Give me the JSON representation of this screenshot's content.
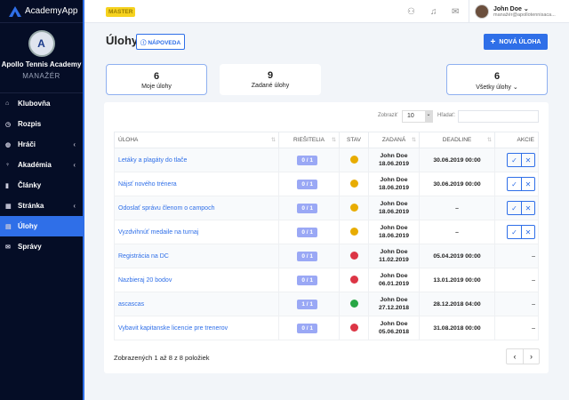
{
  "app": {
    "name": "AcademyApp"
  },
  "club": {
    "name": "Apollo Tennis Academy",
    "role": "MANAŽÉR",
    "logo_text": "A"
  },
  "sidebar": {
    "items": [
      {
        "label": "Klubovňa",
        "icon": "home-icon",
        "chev": false,
        "active": false
      },
      {
        "label": "Rozpis",
        "icon": "clock-icon",
        "chev": false,
        "active": false
      },
      {
        "label": "Hráči",
        "icon": "globe-icon",
        "chev": true,
        "active": false
      },
      {
        "label": "Akadémia",
        "icon": "trophy-icon",
        "chev": true,
        "active": false
      },
      {
        "label": "Články",
        "icon": "document-icon",
        "chev": false,
        "active": false
      },
      {
        "label": "Stránka",
        "icon": "layout-icon",
        "chev": true,
        "active": false
      },
      {
        "label": "Úlohy",
        "icon": "tasks-icon",
        "chev": false,
        "active": true
      },
      {
        "label": "Správy",
        "icon": "mail-icon",
        "chev": false,
        "active": false
      }
    ]
  },
  "topbar": {
    "badge": "MASTER",
    "user_name": "John Doe",
    "user_email": "manažér@apollotennisaca..."
  },
  "page": {
    "title": "Úlohy",
    "help": "NÁPOVEDA",
    "new_task": "NOVÁ ÚLOHA"
  },
  "stats": [
    {
      "value": "6",
      "label": "Moje úlohy"
    },
    {
      "value": "9",
      "label": "Zadané úlohy"
    },
    {
      "value": "6",
      "label": "Všetky úlohy"
    }
  ],
  "table": {
    "show_label": "Zobraziť",
    "show_value": "10",
    "search_label": "Hľadať:",
    "headers": [
      "ÚLOHA",
      "RIEŠITELIA",
      "STAV",
      "ZADANÁ",
      "DEADLINE",
      "AKCIE"
    ],
    "status_colors": {
      "pending": "#e8ac00",
      "failed": "#dc3545",
      "done": "#28a745"
    },
    "rows": [
      {
        "task": "Letáky a plagáty do tlače",
        "solvers": "0 / 1",
        "status": "pending",
        "by": "John Doe",
        "date": "18.06.2019",
        "deadline": "30.06.2019 00:00",
        "actions": true
      },
      {
        "task": "Nájsť nového trénera",
        "solvers": "0 / 1",
        "status": "pending",
        "by": "John Doe",
        "date": "18.06.2019",
        "deadline": "30.06.2019 00:00",
        "actions": true
      },
      {
        "task": "Odoslať správu členom o campoch",
        "solvers": "0 / 1",
        "status": "pending",
        "by": "John Doe",
        "date": "18.06.2019",
        "deadline": "–",
        "actions": true
      },
      {
        "task": "Vyzdvihnúť medaile na turnaj",
        "solvers": "0 / 1",
        "status": "pending",
        "by": "John Doe",
        "date": "18.06.2019",
        "deadline": "–",
        "actions": true
      },
      {
        "task": "Registrácia na DC",
        "solvers": "0 / 1",
        "status": "failed",
        "by": "John Doe",
        "date": "11.02.2019",
        "deadline": "05.04.2019 00:00",
        "actions": false
      },
      {
        "task": "Nazbieraj 20 bodov",
        "solvers": "0 / 1",
        "status": "failed",
        "by": "John Doe",
        "date": "06.01.2019",
        "deadline": "13.01.2019 00:00",
        "actions": false
      },
      {
        "task": "ascascas",
        "solvers": "1 / 1",
        "status": "done",
        "by": "John Doe",
        "date": "27.12.2018",
        "deadline": "28.12.2018 04:00",
        "actions": false
      },
      {
        "task": "Vybavit kapitanske licencie pre trenerov",
        "solvers": "0 / 1",
        "status": "failed",
        "by": "John Doe",
        "date": "05.06.2018",
        "deadline": "31.08.2018 00:00",
        "actions": false
      }
    ],
    "no_action": "–",
    "info": "Zobrazených 1 až 8 z 8 položiek"
  }
}
